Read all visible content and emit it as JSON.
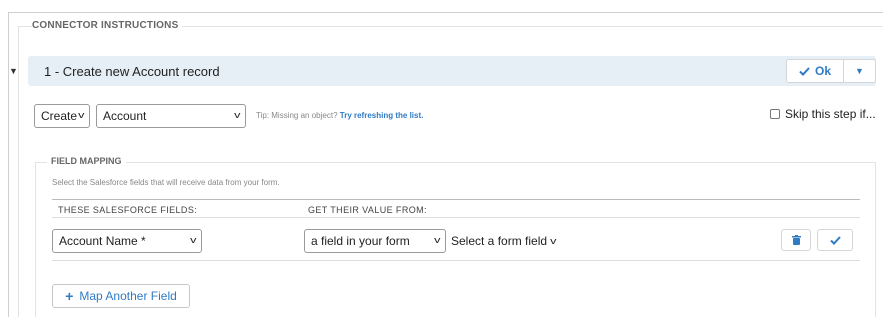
{
  "section": {
    "legend": "CONNECTOR INSTRUCTIONS"
  },
  "step": {
    "title": "1 - Create new Account record",
    "ok_label": "Ok"
  },
  "controls": {
    "action_select": "Create",
    "object_select": "Account",
    "tip_text": "Tip: Missing an object?",
    "tip_link": "Try refreshing the list.",
    "skip_label": "Skip this step if..."
  },
  "field_mapping": {
    "legend": "FIELD MAPPING",
    "description": "Select the Salesforce fields that will receive data from your form.",
    "col1_header": "THESE SALESFORCE FIELDS:",
    "col2_header": "GET THEIR VALUE FROM:",
    "rows": [
      {
        "salesforce_field": "Account Name *",
        "value_source": "a field in your form",
        "form_field": "Select a form field"
      }
    ],
    "add_button": "Map Another Field"
  },
  "colors": {
    "accent": "#2f7bc4",
    "header_bg": "#e6eff6"
  },
  "icons": [
    "caret-down-icon",
    "check-icon",
    "trash-icon",
    "plus-icon",
    "chevron-down-icon"
  ]
}
